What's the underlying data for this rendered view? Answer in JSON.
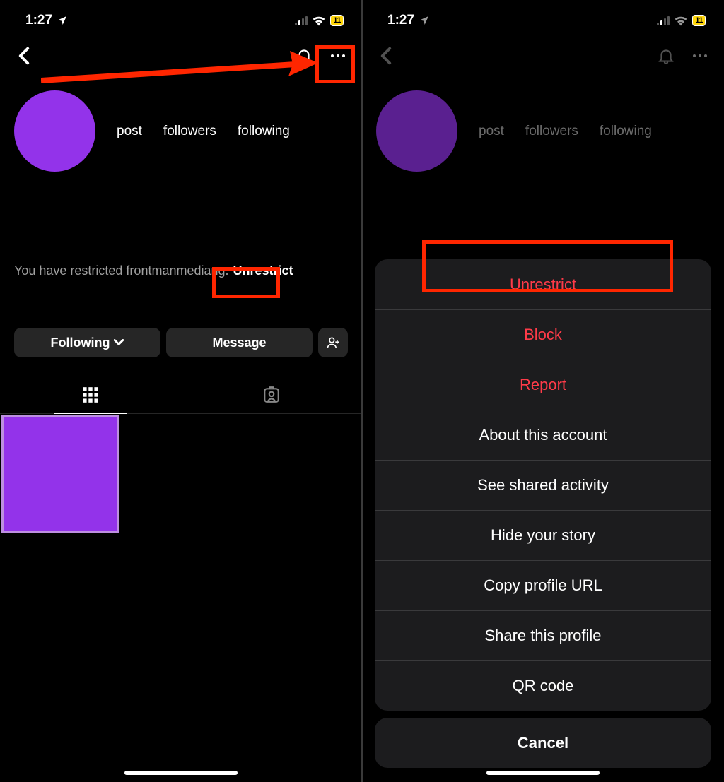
{
  "status": {
    "time": "1:27",
    "battery": "11"
  },
  "profile": {
    "stats": {
      "post": "post",
      "followers": "followers",
      "following": "following"
    },
    "restricted_text": "You have restricted frontmanmediang.",
    "unrestrict_inline": "Unrestrict",
    "following_btn": "Following",
    "message_btn": "Message"
  },
  "sheet": {
    "items": [
      {
        "label": "Unrestrict",
        "danger": true
      },
      {
        "label": "Block",
        "danger": true
      },
      {
        "label": "Report",
        "danger": true
      },
      {
        "label": "About this account",
        "danger": false
      },
      {
        "label": "See shared activity",
        "danger": false
      },
      {
        "label": "Hide your story",
        "danger": false
      },
      {
        "label": "Copy profile URL",
        "danger": false
      },
      {
        "label": "Share this profile",
        "danger": false
      },
      {
        "label": "QR code",
        "danger": false
      }
    ],
    "cancel": "Cancel"
  }
}
